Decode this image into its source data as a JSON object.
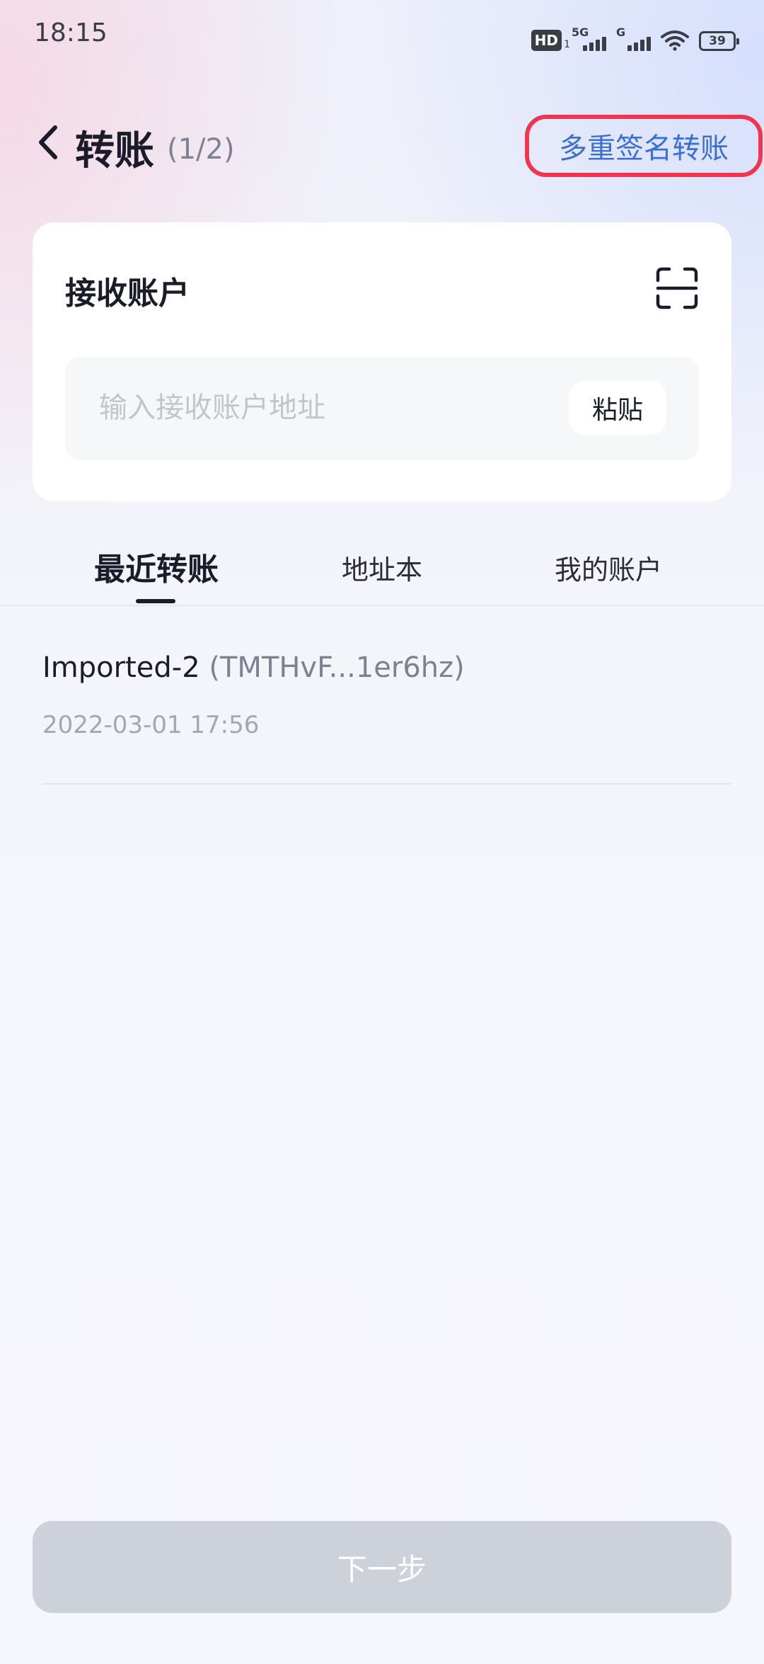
{
  "status_bar": {
    "time": "18:15",
    "hd_label": "HD",
    "hd_sub": "1",
    "net_5g": "5G",
    "net_g": "G",
    "battery": "39"
  },
  "header": {
    "title": "转账",
    "step": "(1/2)",
    "multisig_label": "多重签名转账"
  },
  "receive": {
    "title": "接收账户",
    "placeholder": "输入接收账户地址",
    "value": "",
    "paste_label": "粘贴"
  },
  "tabs": [
    {
      "label": "最近转账",
      "active": true
    },
    {
      "label": "地址本",
      "active": false
    },
    {
      "label": "我的账户",
      "active": false
    }
  ],
  "recent": [
    {
      "name": "Imported-2",
      "address": "(TMTHvF...1er6hz)",
      "time": "2022-03-01 17:56"
    }
  ],
  "next_button": {
    "label": "下一步"
  },
  "colors": {
    "accent": "#3a6fd8",
    "highlight": "#f2354e",
    "disabled_button": "#cdd1d9",
    "text_primary": "#1a1d29"
  }
}
